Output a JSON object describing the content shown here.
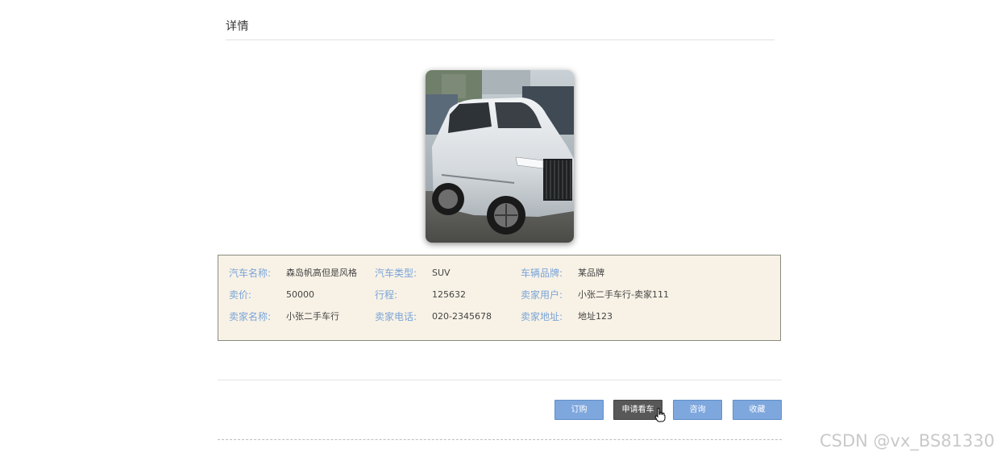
{
  "section": {
    "title": "详情"
  },
  "car_image": {
    "icon": "car-photo"
  },
  "details": {
    "rows": [
      [
        {
          "label": "汽车名称:",
          "value": "森岛帆高但是风格"
        },
        {
          "label": "汽车类型:",
          "value": "SUV"
        },
        {
          "label": "车辆品牌:",
          "value": "某品牌"
        }
      ],
      [
        {
          "label": "卖价:",
          "value": "50000"
        },
        {
          "label": "行程:",
          "value": "125632"
        },
        {
          "label": "卖家用户:",
          "value": "小张二手车行-卖家111"
        }
      ],
      [
        {
          "label": "卖家名称:",
          "value": "小张二手车行"
        },
        {
          "label": "卖家电话:",
          "value": "020-2345678"
        },
        {
          "label": "卖家地址:",
          "value": "地址123"
        }
      ]
    ]
  },
  "actions": {
    "order": "订购",
    "apply_view": "申请看车",
    "consult": "咨询",
    "favorite": "收藏"
  },
  "colors": {
    "label": "#79a4d8",
    "button": "#7ea7dd",
    "button_active": "#585858",
    "info_bg": "#f8f2e6"
  },
  "watermark": "CSDN @vx_BS81330"
}
